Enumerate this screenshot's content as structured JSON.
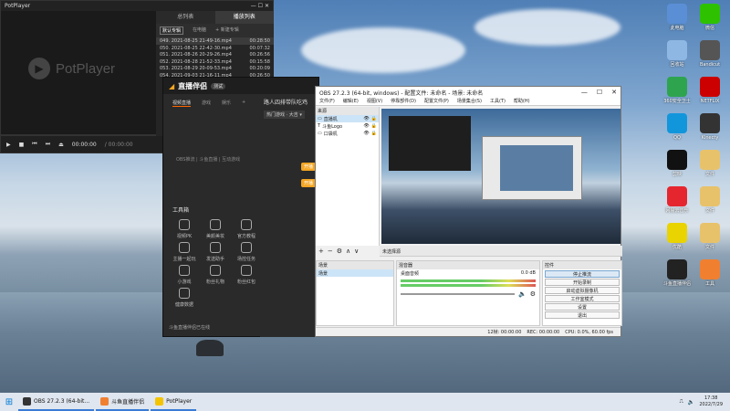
{
  "potplayer": {
    "title": "PotPlayer",
    "logo_text": "PotPlayer",
    "tabs": [
      "总列表",
      "播放列表"
    ],
    "subtabs": [
      "默认专辑",
      "在电脑",
      "+ 新建专辑"
    ],
    "files": [
      {
        "name": "049. 2021-08-25 21-49-16.mp4",
        "duration": "00:28:50"
      },
      {
        "name": "050. 2021-08-25 22-42-30.mp4",
        "duration": "00:07:32"
      },
      {
        "name": "051. 2021-08-26 20-29-26.mp4",
        "duration": "00:26:56"
      },
      {
        "name": "052. 2021-08-28 21-52-33.mp4",
        "duration": "00:15:58"
      },
      {
        "name": "053. 2021-08-29 20-09-53.mp4",
        "duration": "00:20:09"
      },
      {
        "name": "054. 2021-09-03 21-16-11.mp4",
        "duration": "00:26:50"
      }
    ],
    "time": "00:00:00",
    "total": "/ 00:00:00"
  },
  "douyu": {
    "app_name": "直播伴侣",
    "badge": "测试",
    "tabs": [
      "视频直播",
      "游戏",
      "娱乐",
      "+"
    ],
    "hint": "OBS推流 | 斗鱼直播 | 互动游戏",
    "section": "工具箱",
    "tools": [
      "视频PK",
      "美颜美妆",
      "官方教程",
      "主播一起玩",
      "发送助手",
      "场控任务",
      "小游戏",
      "粉丝礼物",
      "粉丝红包",
      "健康数据"
    ],
    "footer": "斗鱼直播伴侣已在线",
    "right_title": "路人四排带队吃鸡",
    "chip": "热门游戏 · 大吉 ▾",
    "orange1": "开播",
    "orange2": "开播"
  },
  "obs": {
    "title": "OBS 27.2.3 (64-bit, windows) - 配置文件: 未命名 - 场景: 未命名",
    "menu": [
      "文件(F)",
      "编辑(E)",
      "视图(V)",
      "停靠部件(D)",
      "配置文件(P)",
      "场景集合(S)",
      "工具(T)",
      "帮助(H)"
    ],
    "scenes_header": "来源",
    "sources": [
      "直播机",
      "斗鱼Logo",
      "口袋机"
    ],
    "selected_label": "未选择源",
    "panel_scenes": "场景",
    "scene_item": "场景",
    "mixer_header": "混音器",
    "mixer_track": "桌面音频",
    "mixer_value": "0.0 dB",
    "controls_header": "控件",
    "buttons": [
      "停止推流",
      "开始录制",
      "启动虚拟摄像机",
      "工作室模式",
      "设置",
      "退出"
    ],
    "status": [
      "12帧: 00:00:00",
      "REC: 00:00:00",
      "CPU: 0.0%, 60.00 fps"
    ]
  },
  "desktop_icons": [
    {
      "label": "此电脑",
      "color": "#5a8fd6"
    },
    {
      "label": "微信",
      "color": "#2dc100"
    },
    {
      "label": "回收站",
      "color": "#8fb7e3"
    },
    {
      "label": "Bandicut",
      "color": "#555"
    },
    {
      "label": "360安全卫士",
      "color": "#2ea44f"
    },
    {
      "label": "NETFLIX",
      "color": "#c00"
    },
    {
      "label": "QQ",
      "color": "#1296db"
    },
    {
      "label": "Kinecty",
      "color": "#333"
    },
    {
      "label": "剪映",
      "color": "#111"
    },
    {
      "label": "文件",
      "color": "#e8c26a"
    },
    {
      "label": "网易云音乐",
      "color": "#e5262f"
    },
    {
      "label": "文件",
      "color": "#e8c26a"
    },
    {
      "label": "优酷",
      "color": "#e9d300"
    },
    {
      "label": "文件",
      "color": "#e8c26a"
    },
    {
      "label": "斗鱼直播伴侣",
      "color": "#222"
    },
    {
      "label": "工具",
      "color": "#f08030"
    }
  ],
  "taskbar": {
    "items": [
      {
        "label": "OBS 27.2.3 (64-bit...",
        "color": "#333"
      },
      {
        "label": "斗鱼直播伴侣",
        "color": "#f08030"
      },
      {
        "label": "PotPlayer",
        "color": "#f5c400"
      }
    ],
    "time": "17:38",
    "date": "2022/7/29"
  }
}
